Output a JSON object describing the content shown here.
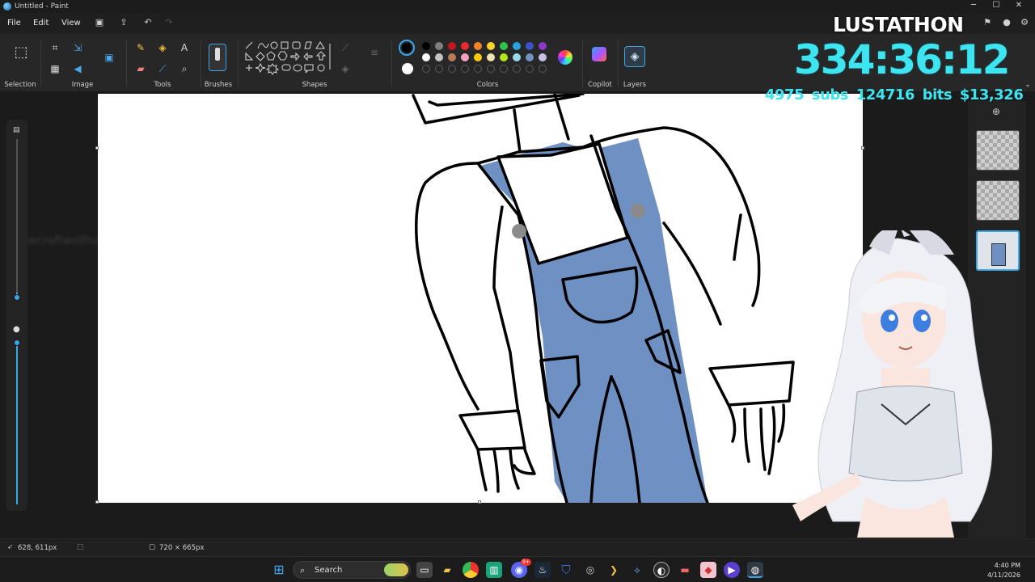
{
  "window": {
    "title": "Untitled - Paint",
    "minimize": "─",
    "maximize": "☐",
    "close": "✕"
  },
  "menu": {
    "file": "File",
    "edit": "Edit",
    "view": "View"
  },
  "ribbon": {
    "groups": {
      "selection": "Selection",
      "image": "Image",
      "tools": "Tools",
      "brushes": "Brushes",
      "shapes": "Shapes",
      "colors": "Colors",
      "copilot": "Copilot",
      "layers": "Layers"
    },
    "palette_row1": [
      "#000000",
      "#7f7f7f",
      "#c3171f",
      "#e82a2a",
      "#f5822a",
      "#fbd32c",
      "#31c24a",
      "#2aa2dc",
      "#3a53c6",
      "#8a3ac6"
    ],
    "palette_row2": [
      "#ffffff",
      "#c3c3c3",
      "#b97a57",
      "#f5a0c0",
      "#ffc90e",
      "#efe4b0",
      "#b5e61d",
      "#99d9ea",
      "#7092be",
      "#c8bfe7"
    ],
    "primary_color": "#000000",
    "secondary_color": "#ffffff"
  },
  "ghost_chat": "minecraftwolfhound3247: finally",
  "overlay": {
    "title": "LUSTATHON",
    "timer": "334:36:12",
    "subs": "4975 subs",
    "bits": "124716 bits",
    "money": "$13,326"
  },
  "layers": {
    "count": 3,
    "active_index": 2
  },
  "status": {
    "cursor_position": "628, 611px",
    "canvas_size": "720 × 665px"
  },
  "taskbar": {
    "search_placeholder": "Search",
    "time": "4:40 PM",
    "date": "4/11/2026",
    "discord_badge": "9+"
  },
  "canvas": {
    "overalls_color": "#6f90c2",
    "button_color": "#8a8a8a"
  }
}
